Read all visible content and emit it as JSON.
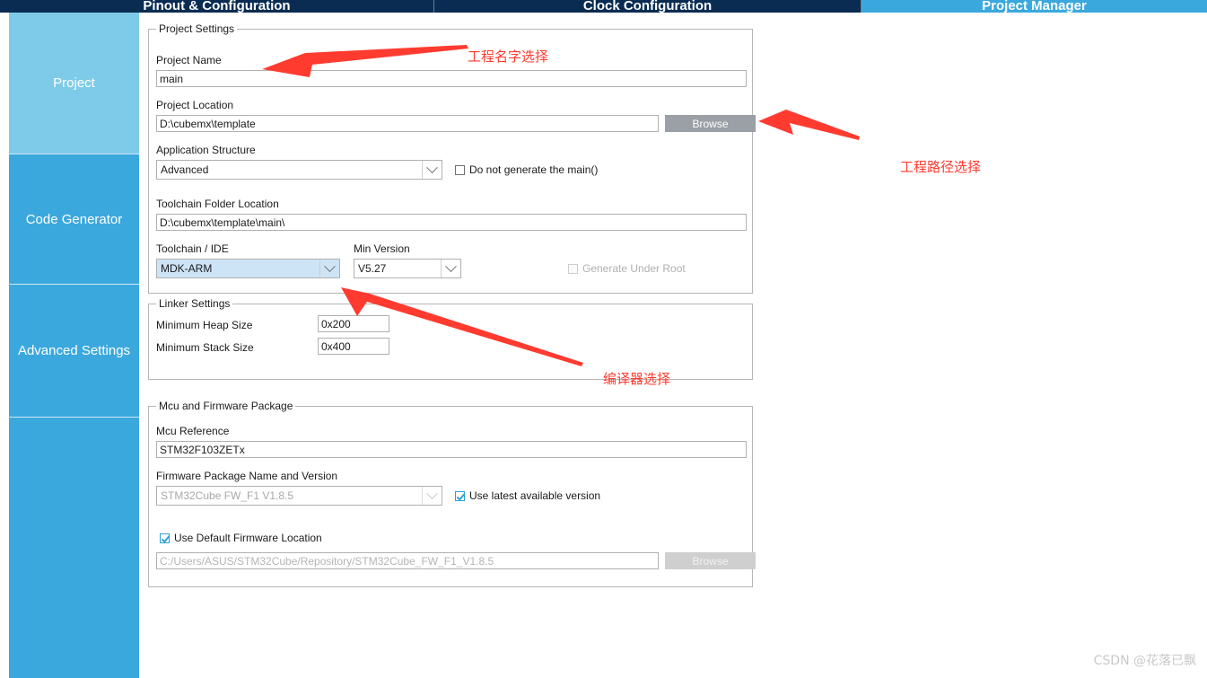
{
  "window": {
    "tabs": [
      {
        "label": "Pinout & Configuration",
        "active": false
      },
      {
        "label": "Clock Configuration",
        "active": false
      },
      {
        "label": "Project Manager",
        "active": true
      }
    ]
  },
  "sidebar": {
    "items": [
      {
        "label": "Project"
      },
      {
        "label": "Code Generator"
      },
      {
        "label": "Advanced Settings"
      },
      {
        "label": ""
      }
    ],
    "selected_index": 0,
    "selected_bg": "#7ecbe9",
    "bg": "#3ba8dd"
  },
  "project_settings": {
    "group_title": "Project Settings",
    "project_name_label": "Project Name",
    "project_name_value": "main",
    "project_location_label": "Project Location",
    "project_location_value": "D:\\cubemx\\template",
    "project_location_browse": "Browse",
    "application_structure_label": "Application Structure",
    "application_structure_value": "Advanced",
    "do_not_generate_main_label": "Do not generate the main()",
    "do_not_generate_main_checked": false,
    "toolchain_folder_label": "Toolchain Folder Location",
    "toolchain_folder_value": "D:\\cubemx\\template\\main\\",
    "toolchain_ide_label": "Toolchain / IDE",
    "toolchain_ide_value": "MDK-ARM",
    "min_version_label": "Min Version",
    "min_version_value": "V5.27",
    "generate_under_root_label": "Generate Under Root",
    "generate_under_root_checked": false,
    "generate_under_root_disabled": true
  },
  "linker_settings": {
    "group_title": "Linker Settings",
    "min_heap_label": "Minimum Heap Size",
    "min_heap_value": "0x200",
    "min_stack_label": "Minimum Stack Size",
    "min_stack_value": "0x400"
  },
  "mcu_firmware": {
    "group_title": "Mcu and Firmware Package",
    "mcu_reference_label": "Mcu Reference",
    "mcu_reference_value": "STM32F103ZETx",
    "firmware_package_label": "Firmware Package Name and Version",
    "firmware_package_value": "STM32Cube FW_F1 V1.8.5",
    "use_latest_label": "Use latest available version",
    "use_latest_checked": true,
    "use_default_location_label": "Use Default Firmware Location",
    "use_default_location_checked": true,
    "firmware_location_value": "C:/Users/ASUS/STM32Cube/Repository/STM32Cube_FW_F1_V1.8.5",
    "firmware_browse": "Browse"
  },
  "annotations": {
    "color": "#ff3b30",
    "items": [
      {
        "text": "工程名字选择"
      },
      {
        "text": "工程路径选择"
      },
      {
        "text": "编译器选择"
      }
    ]
  },
  "watermark": {
    "text": "CSDN @花落已飘"
  }
}
